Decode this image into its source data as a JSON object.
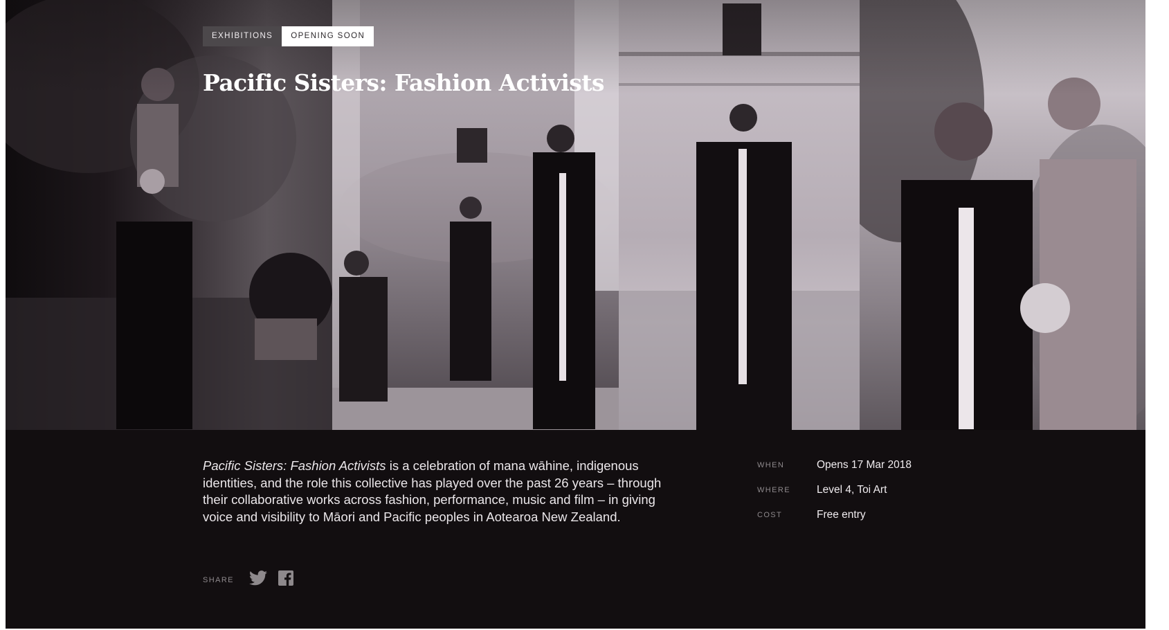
{
  "tags": {
    "primary": "Exhibitions",
    "status": "Opening soon"
  },
  "title": "Pacific Sisters: Fashion Activists",
  "description": {
    "italic_title": "Pacific Sisters: Fashion Activists",
    "body": " is a celebration of mana wāhine, indigenous identities, and the role this collective has played over the past 26 years – through their collaborative works across fashion, performance, music and film – in giving voice and visibility to Māori and Pacific peoples in Aotearoa New Zealand."
  },
  "details": [
    {
      "label": "When",
      "value": "Opens 17 Mar 2018"
    },
    {
      "label": "Where",
      "value": "Level 4, Toi Art"
    },
    {
      "label": "Cost",
      "value": "Free entry"
    }
  ],
  "share": {
    "label": "Share",
    "icons": [
      "twitter-icon",
      "facebook-icon"
    ]
  },
  "colors": {
    "background": "#120e10",
    "text": "#ebe7ea",
    "muted": "#8e898c"
  }
}
